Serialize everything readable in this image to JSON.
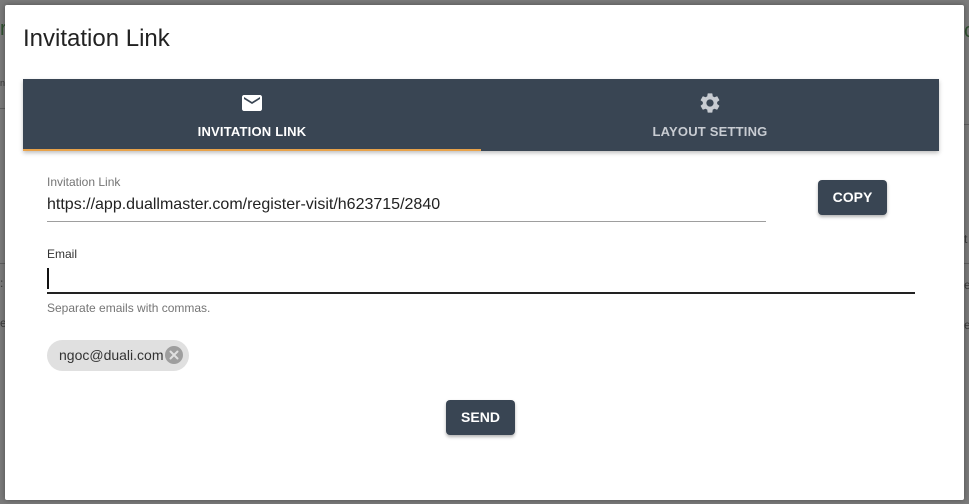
{
  "dialog": {
    "title": "Invitation Link"
  },
  "tabs": [
    {
      "label": "INVITATION LINK",
      "icon": "mail-icon",
      "active": true
    },
    {
      "label": "LAYOUT SETTING",
      "icon": "gear-icon",
      "active": false
    }
  ],
  "invitation": {
    "label": "Invitation Link",
    "value": "https://app.duallmaster.com/register-visit/h623715/2840",
    "copy_label": "COPY"
  },
  "email": {
    "label": "Email",
    "value": "",
    "hint": "Separate emails with commas."
  },
  "chips": [
    {
      "label": "ngoc@duali.com"
    }
  ],
  "send_label": "SEND",
  "colors": {
    "header_bg": "#394553",
    "accent": "#e8a24a",
    "button_bg": "#394553",
    "chip_bg": "#e0e0e0"
  }
}
